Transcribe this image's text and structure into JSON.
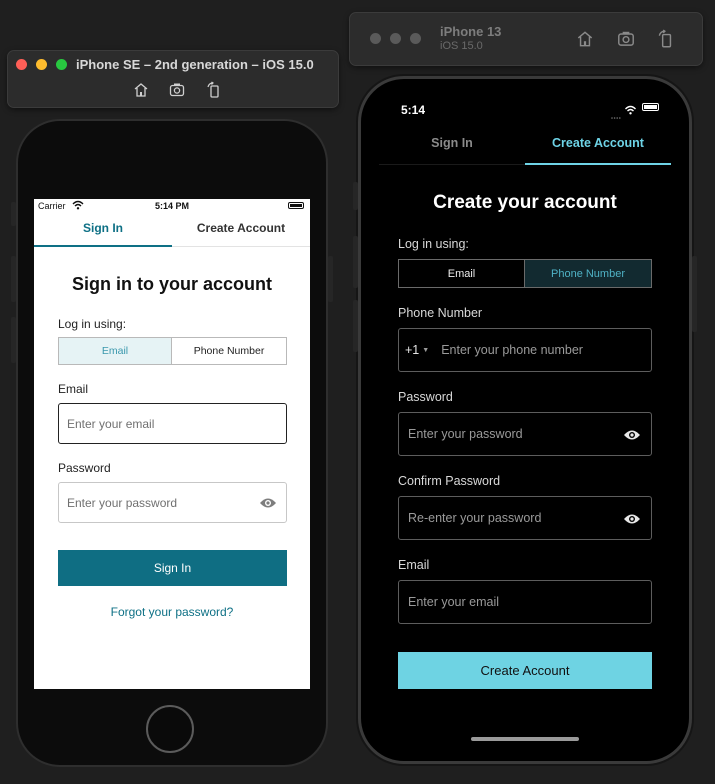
{
  "simulators": {
    "left": {
      "title": "iPhone SE – 2nd generation – iOS 15.0"
    },
    "right": {
      "title": "iPhone 13",
      "subtitle": "iOS 15.0"
    }
  },
  "toolbar_icons": [
    "home-icon",
    "screenshot-icon",
    "rotate-icon"
  ],
  "colors": {
    "traffic_close": "#ff5f57",
    "traffic_minimize": "#febc2e",
    "traffic_zoom": "#28c840",
    "light_accent": "#0e7085",
    "dark_accent": "#6ed3e6"
  },
  "sign_in_screen": {
    "status": {
      "carrier": "Carrier",
      "time": "5:14 PM"
    },
    "tabs": {
      "sign_in": "Sign In",
      "create_account": "Create Account",
      "active": "sign_in"
    },
    "heading": "Sign in to your account",
    "login_using_label": "Log in using:",
    "segmented": {
      "email": "Email",
      "phone": "Phone Number",
      "selected": "email"
    },
    "email_label": "Email",
    "email_placeholder": "Enter your email",
    "password_label": "Password",
    "password_placeholder": "Enter your password",
    "submit_label": "Sign In",
    "forgot_link": "Forgot your password?"
  },
  "create_account_screen": {
    "status": {
      "time": "5:14"
    },
    "tabs": {
      "sign_in": "Sign In",
      "create_account": "Create Account",
      "active": "create_account"
    },
    "heading": "Create your account",
    "login_using_label": "Log in using:",
    "segmented": {
      "email": "Email",
      "phone": "Phone Number",
      "selected": "phone"
    },
    "phone_label": "Phone Number",
    "country_code": "+1",
    "phone_placeholder": "Enter your phone number",
    "password_label": "Password",
    "password_placeholder": "Enter your password",
    "confirm_label": "Confirm Password",
    "confirm_placeholder": "Re-enter your password",
    "email_label": "Email",
    "email_placeholder": "Enter your email",
    "submit_label": "Create Account"
  }
}
